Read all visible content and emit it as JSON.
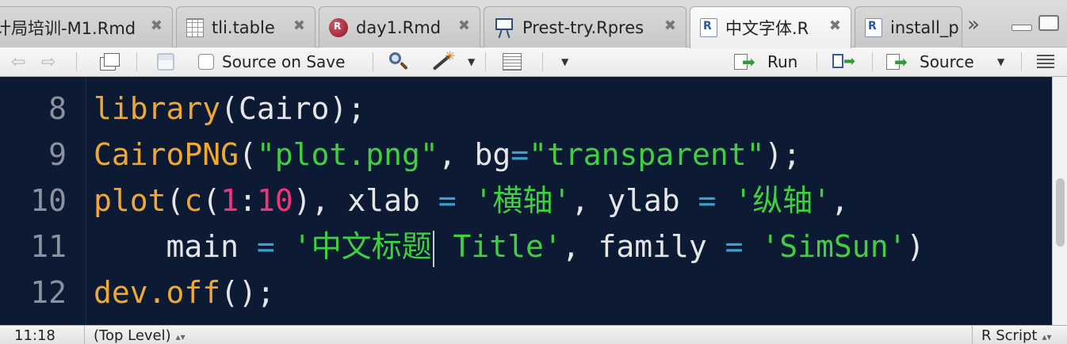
{
  "tabs": [
    {
      "label": "计局培训-M1.Rmd",
      "icon": "rmd-icon",
      "active": false
    },
    {
      "label": "tli.table",
      "icon": "table-icon",
      "active": false
    },
    {
      "label": "day1.Rmd",
      "icon": "rmd-icon",
      "active": false
    },
    {
      "label": "Prest-try.Rpres",
      "icon": "presentation-icon",
      "active": false
    },
    {
      "label": "中文字体.R",
      "icon": "r-script-icon",
      "active": true
    },
    {
      "label": "install_p",
      "icon": "r-script-icon",
      "active": false
    }
  ],
  "tab_close_glyph": "✖",
  "tab_overflow_glyph": "»",
  "toolbar": {
    "source_on_save_label": "Source on Save",
    "run_label": "Run",
    "source_label": "Source"
  },
  "editor": {
    "lines": [
      {
        "number": "8"
      },
      {
        "number": "9"
      },
      {
        "number": "10"
      },
      {
        "number": "11"
      },
      {
        "number": "12"
      }
    ],
    "code": {
      "l8_fn": "library",
      "l8_rest": "(Cairo);",
      "l9_fn": "CairoPNG",
      "l9_p1": "(",
      "l9_str1": "\"plot.png\"",
      "l9_p2": ", bg",
      "l9_eq": "=",
      "l9_str2": "\"transparent\"",
      "l9_p3": ");",
      "l10_fn1": "plot",
      "l10_p1": "(",
      "l10_fn2": "c",
      "l10_p2": "(",
      "l10_n1": "1",
      "l10_colon": ":",
      "l10_n2": "10",
      "l10_p3": "), xlab ",
      "l10_eq1": "=",
      "l10_sp1": " ",
      "l10_str1": "'横轴'",
      "l10_p4": ", ylab ",
      "l10_eq2": "=",
      "l10_sp2": " ",
      "l10_str2": "'纵轴'",
      "l10_p5": ",",
      "l11_indent": "    main ",
      "l11_eq1": "=",
      "l11_sp1": " ",
      "l11_str1a": "'中文标题",
      "l11_str1b": " Title'",
      "l11_p1": ", family ",
      "l11_eq2": "=",
      "l11_sp2": " ",
      "l11_str2": "'SimSun'",
      "l11_p2": ")",
      "l12_fn": "dev.off",
      "l12_rest": "();"
    },
    "colors": {
      "background": "#0c1b33",
      "function": "#f0a830",
      "string": "#3fcf3f",
      "number": "#f0357a",
      "operator": "#3fa0d0",
      "text": "#e6e6e6",
      "line_number": "#8a92a0"
    }
  },
  "status": {
    "cursor_position": "11:18",
    "scope": "(Top Level)",
    "file_type": "R Script"
  }
}
